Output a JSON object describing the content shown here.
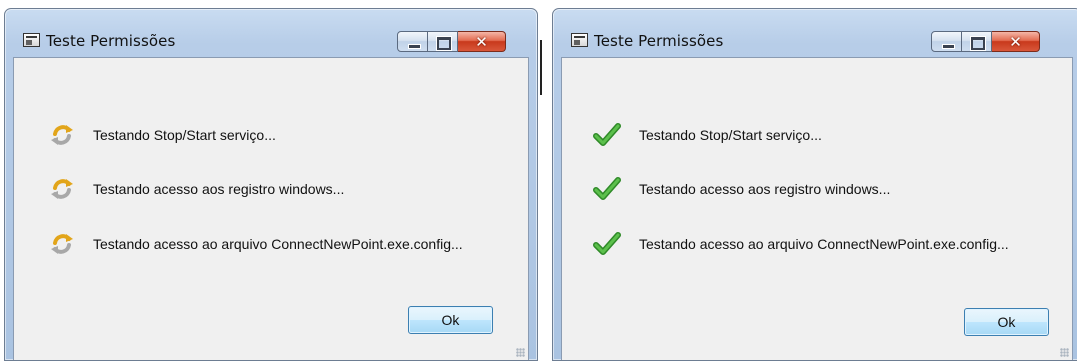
{
  "windows": [
    {
      "title": "Teste Permissões",
      "status": "in-progress",
      "items": [
        {
          "label": "Testando Stop/Start serviço...",
          "icon": "refresh-icon"
        },
        {
          "label": "Testando acesso aos registro windows...",
          "icon": "refresh-icon"
        },
        {
          "label": "Testando acesso ao arquivo ConnectNewPoint.exe.config...",
          "icon": "refresh-icon"
        }
      ],
      "ok_label": "Ok"
    },
    {
      "title": "Teste Permissões",
      "status": "completed",
      "items": [
        {
          "label": "Testando Stop/Start serviço...",
          "icon": "checkmark-icon"
        },
        {
          "label": "Testando acesso aos registro windows...",
          "icon": "checkmark-icon"
        },
        {
          "label": "Testando acesso ao arquivo ConnectNewPoint.exe.config...",
          "icon": "checkmark-icon"
        }
      ],
      "ok_label": "Ok"
    }
  ],
  "colors": {
    "check_green": "#3fa535",
    "refresh_orange": "#e2a51a",
    "refresh_gray": "#a8a8a8"
  }
}
